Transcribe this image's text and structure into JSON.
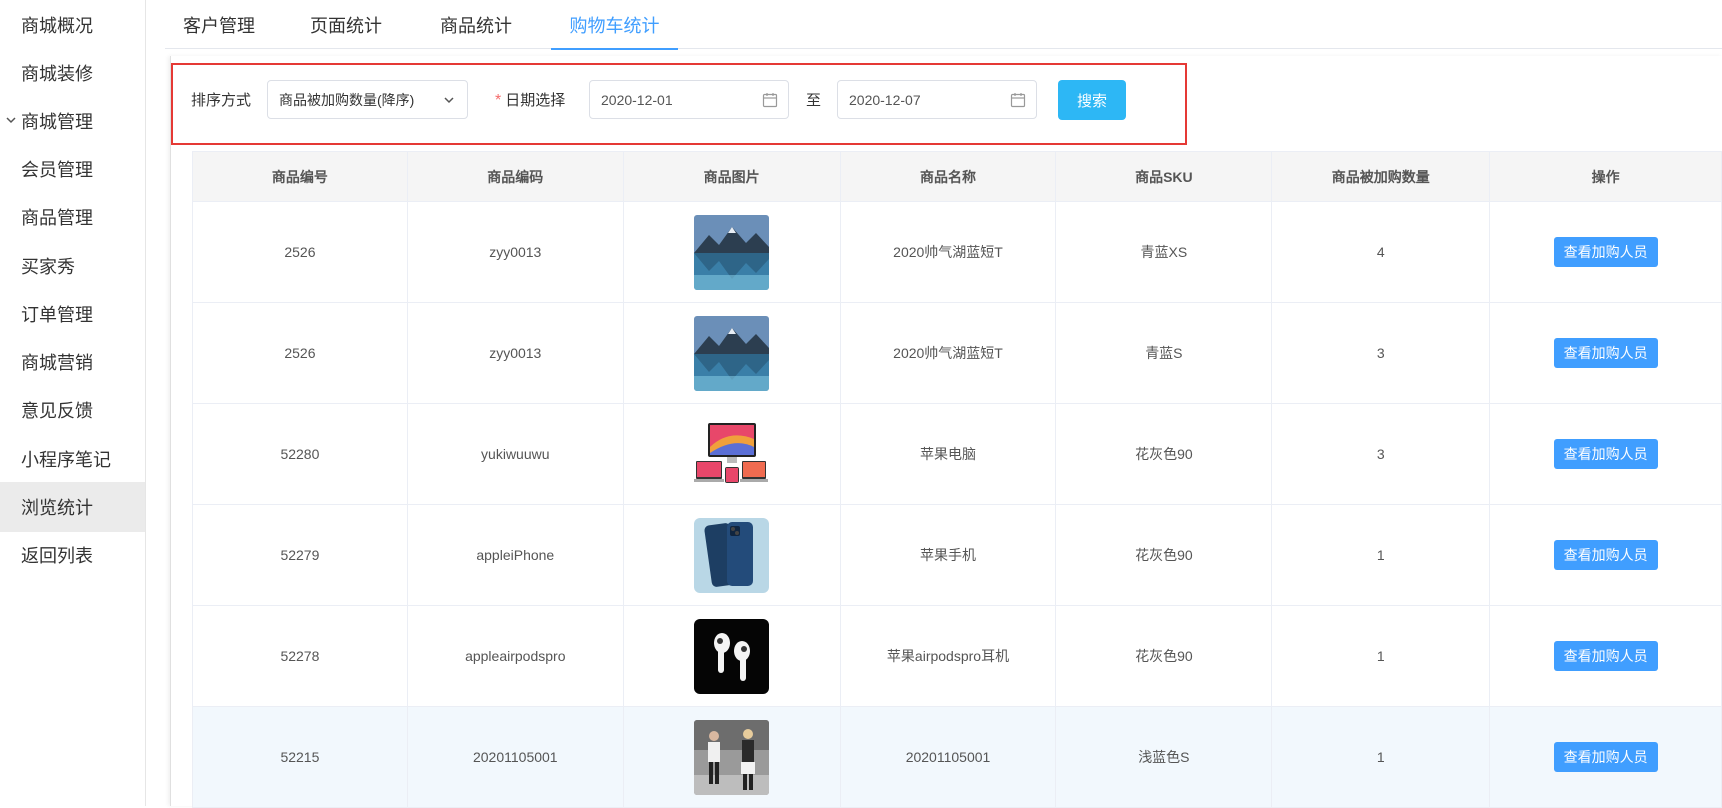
{
  "sidebar": {
    "items": [
      {
        "label": "商城概况"
      },
      {
        "label": "商城装修"
      },
      {
        "label": "商城管理"
      },
      {
        "label": "会员管理"
      },
      {
        "label": "商品管理"
      },
      {
        "label": "买家秀"
      },
      {
        "label": "订单管理"
      },
      {
        "label": "商城营销"
      },
      {
        "label": "意见反馈"
      },
      {
        "label": "小程序笔记"
      },
      {
        "label": "浏览统计"
      },
      {
        "label": "返回列表"
      }
    ],
    "active": "浏览统计"
  },
  "tabs": [
    {
      "label": "客户管理"
    },
    {
      "label": "页面统计"
    },
    {
      "label": "商品统计"
    },
    {
      "label": "购物车统计"
    }
  ],
  "active_tab": "购物车统计",
  "filters": {
    "sort_label": "排序方式",
    "sort_value": "商品被加购数量(降序)",
    "date_label": "日期选择",
    "required_mark": "*",
    "start_date": "2020-12-01",
    "range_separator": "至",
    "end_date": "2020-12-07",
    "search_button": "搜索"
  },
  "table": {
    "columns": [
      "商品编号",
      "商品编码",
      "商品图片",
      "商品名称",
      "商品SKU",
      "商品被加购数量",
      "操作"
    ],
    "action_label": "查看加购人员",
    "rows": [
      {
        "id": "2526",
        "code": "zyy0013",
        "image": "mountain-lake-image",
        "name": "2020帅气湖蓝短T",
        "sku": "青蓝XS",
        "count": "4"
      },
      {
        "id": "2526",
        "code": "zyy0013",
        "image": "mountain-lake-image",
        "name": "2020帅气湖蓝短T",
        "sku": "青蓝S",
        "count": "3"
      },
      {
        "id": "52280",
        "code": "yukiwuuwu",
        "image": "apple-devices-image",
        "name": "苹果电脑",
        "sku": "花灰色90",
        "count": "3"
      },
      {
        "id": "52279",
        "code": "appleiPhone",
        "image": "iphone-image",
        "name": "苹果手机",
        "sku": "花灰色90",
        "count": "1"
      },
      {
        "id": "52278",
        "code": "appleairpodspro",
        "image": "airpods-image",
        "name": "苹果airpodspro耳机",
        "sku": "花灰色90",
        "count": "1"
      },
      {
        "id": "52215",
        "code": "20201105001",
        "image": "fashion-photo-image",
        "name": "20201105001",
        "sku": "浅蓝色S",
        "count": "1"
      }
    ]
  },
  "colors": {
    "accent": "#409eff",
    "search_button": "#2db7f5",
    "highlight_box": "#e53935"
  }
}
